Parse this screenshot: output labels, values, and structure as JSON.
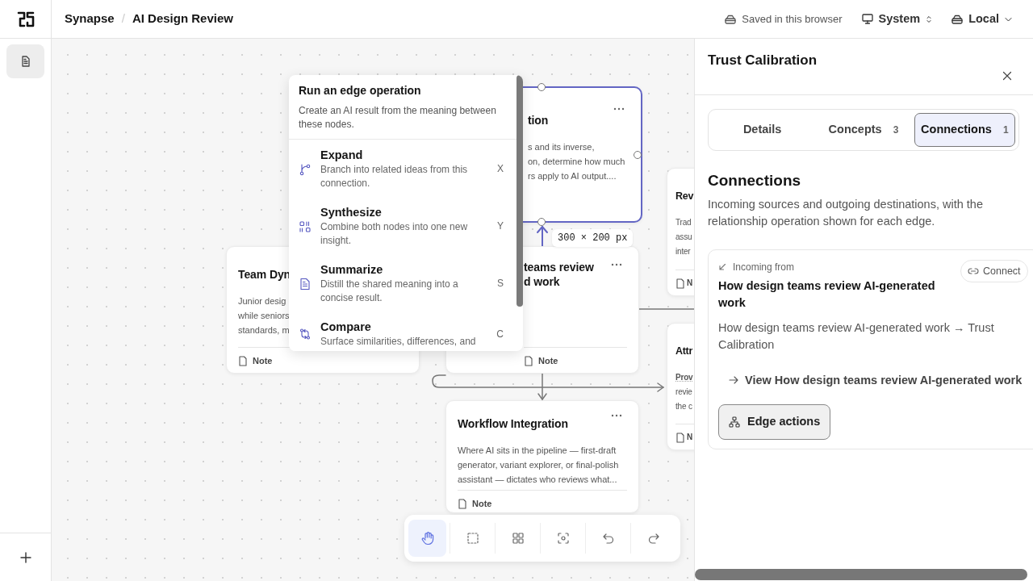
{
  "header": {
    "breadcrumb": [
      "Synapse",
      "AI Design Review"
    ],
    "breadcrumb_separator": "/",
    "save_status": "Saved in this browser",
    "theme": "System",
    "storage": "Local"
  },
  "rail": {
    "items": [
      {
        "selected": true
      }
    ]
  },
  "canvas": {
    "nodes": [
      {
        "title": [
          "tion"
        ],
        "body": [
          "s and its inverse,",
          "on, determine how much",
          "rs apply to AI output...."
        ],
        "selected": true
      },
      {
        "title": [
          "Team Dyn"
        ],
        "body": [
          "Junior desig",
          "while seniors",
          "standards, m"
        ],
        "footer": "Note",
        "selected": false
      },
      {
        "title": [
          "teams review",
          "d work"
        ],
        "footer": "Note",
        "selected": false
      },
      {
        "title": [
          "Rev"
        ],
        "body": [
          "Trad",
          "assu",
          "inter"
        ],
        "footer": "N",
        "selected": false
      },
      {
        "title": [
          "Attr"
        ],
        "body": [
          "**Prov**",
          "revie",
          "the c"
        ],
        "footer": "N",
        "selected": false
      },
      {
        "title": [
          "Workflow Integration"
        ],
        "body": [
          "Where AI sits in the pipeline — first-draft",
          "generator, variant explorer, or final-polish",
          "assistant — dictates who reviews what..."
        ],
        "footer": "Note",
        "selected": false
      }
    ],
    "size_label": "300 × 200 px"
  },
  "edge_menu": {
    "title": "Run an edge operation",
    "description": "Create an AI result from the meaning between these nodes.",
    "items": [
      {
        "kind": "expand",
        "label": "Expand",
        "description": "Branch into related ideas from this connection.",
        "shortcut": "X"
      },
      {
        "kind": "synthesize",
        "label": "Synthesize",
        "description": "Combine both nodes into one new insight.",
        "shortcut": "Y"
      },
      {
        "kind": "summarize",
        "label": "Summarize",
        "description": "Distill the shared meaning into a concise result.",
        "shortcut": "S"
      },
      {
        "kind": "compare",
        "label": "Compare",
        "description": "Surface similarities, differences, and",
        "shortcut": "C"
      }
    ]
  },
  "toolbar": {
    "tools": [
      {
        "kind": "pan",
        "selected": true
      },
      {
        "kind": "select",
        "selected": false
      },
      {
        "kind": "grid",
        "selected": false
      },
      {
        "kind": "focus",
        "selected": false
      },
      {
        "kind": "undo",
        "selected": false
      },
      {
        "kind": "redo",
        "selected": false
      }
    ]
  },
  "panel": {
    "title": "Trust Calibration",
    "tabs": [
      {
        "label": "Details",
        "selected": false
      },
      {
        "label": "Concepts",
        "count": "3",
        "selected": false
      },
      {
        "label": "Connections",
        "count": "1",
        "selected": true
      }
    ],
    "section_title": "Connections",
    "section_description": "Incoming sources and outgoing destinations, with the relationship operation shown for each edge.",
    "connections": [
      {
        "direction": "Incoming from",
        "connect_button": "Connect",
        "title": "How design teams review AI-generated work",
        "path": "How design teams review AI-generated work → Trust Calibration",
        "view_link": "View How design teams review AI-generated work",
        "action_button": "Edge actions"
      }
    ]
  }
}
